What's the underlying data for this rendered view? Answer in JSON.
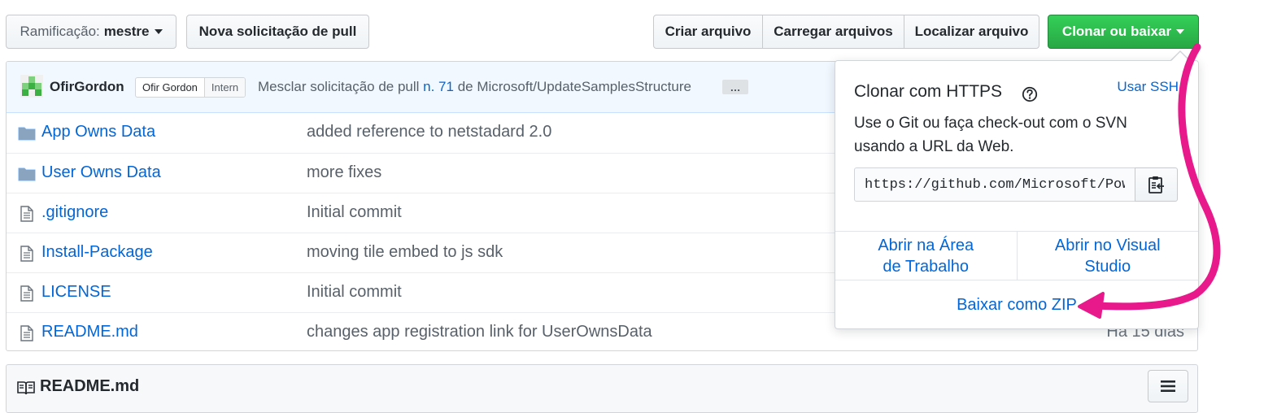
{
  "toolbar": {
    "branch_prefix": "Ramificação:",
    "branch_name": "mestre",
    "new_pull_request": "Nova solicitação de pull",
    "create_file": "Criar arquivo",
    "upload_files": "Carregar arquivos",
    "find_file": "Localizar arquivo",
    "clone_or_download": "Clonar ou baixar"
  },
  "commit": {
    "author": "OfirGordon",
    "badge_name": "Ofir Gordon",
    "badge_role": "Intern",
    "message_prefix": "Mesclar solicitação de pull",
    "pr_link": "n. 71",
    "message_suffix": "de Microsoft/UpdateSamplesStructure",
    "ellipsis": "…"
  },
  "files": [
    {
      "type": "folder",
      "name": "App Owns Data",
      "message": "added reference to netstadard 2.0",
      "age": ""
    },
    {
      "type": "folder",
      "name": "User Owns Data",
      "message": "more fixes",
      "age": ""
    },
    {
      "type": "file",
      "name": ".gitignore",
      "message": "Initial commit",
      "age": ""
    },
    {
      "type": "file",
      "name": "Install-Package",
      "message": "moving tile embed to js sdk",
      "age": ""
    },
    {
      "type": "file",
      "name": "LICENSE",
      "message": "Initial commit",
      "age": ""
    },
    {
      "type": "file",
      "name": "README.md",
      "message": "changes app registration link for UserOwnsData",
      "age": "Há 15 dias"
    }
  ],
  "readme": {
    "title": "README.md"
  },
  "clone_popover": {
    "title": "Clonar com HTTPS",
    "use_ssh": "Usar SSH",
    "description": "Use o Git ou faça check-out com o SVN usando a URL da Web.",
    "url": "https://github.com/Microsoft/PowerBI-Developer-Samples.git",
    "open_desktop": "Abrir na Área de Trabalho",
    "open_visual_studio": "Abrir no Visual Studio",
    "download_zip": "Baixar como ZIP"
  },
  "colors": {
    "green_button": "#2ea44f",
    "link_blue": "#0366d6",
    "annotation_arrow": "#e8198b",
    "commit_bar": "#f1f8ff"
  },
  "icons": {
    "folder": "folder-icon",
    "file": "file-icon",
    "help": "question-circle-icon",
    "copy": "clipboard-icon",
    "book": "book-icon",
    "menu": "hamburger-icon"
  }
}
